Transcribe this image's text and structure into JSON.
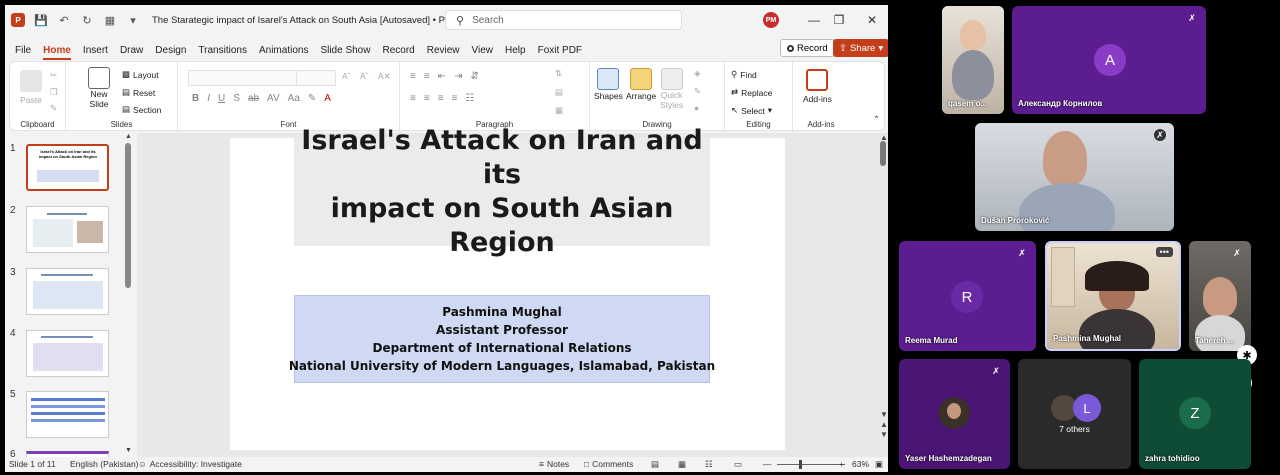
{
  "window": {
    "title": "The Starategic impact of Isarel's Attack on South Asia [Autosaved]  •  PowerP...",
    "search_placeholder": "Search",
    "user_initials": "PM"
  },
  "menu": {
    "tabs": [
      "File",
      "Home",
      "Insert",
      "Draw",
      "Design",
      "Transitions",
      "Animations",
      "Slide Show",
      "Record",
      "Review",
      "View",
      "Help",
      "Foxit PDF"
    ],
    "active": "Home",
    "record_label": "Record",
    "share_label": "Share"
  },
  "ribbon": {
    "clipboard": {
      "paste": "Paste",
      "label": "Clipboard"
    },
    "slides": {
      "new_slide": "New",
      "new_slide2": "Slide",
      "layout": "Layout",
      "reset": "Reset",
      "section": "Section",
      "label": "Slides"
    },
    "font": {
      "label": "Font"
    },
    "paragraph": {
      "label": "Paragraph"
    },
    "drawing": {
      "shapes": "Shapes",
      "arrange": "Arrange",
      "quick_styles": "Quick",
      "quick_styles2": "Styles",
      "label": "Drawing"
    },
    "editing": {
      "find": "Find",
      "replace": "Replace",
      "select": "Select",
      "label": "Editing"
    },
    "addins": {
      "addins": "Add-ins",
      "label": "Add-ins"
    }
  },
  "thumbnails": {
    "numbers": [
      "1",
      "2",
      "3",
      "4",
      "5",
      "6"
    ],
    "thumb1_title": "Israel's Attack on Iran and its impact on South Asian Region"
  },
  "slide": {
    "title_line1": "Israel's Attack on Iran and its",
    "title_line2": "impact on South Asian Region",
    "author_lines": [
      "Pashmina Mughal",
      "Assistant Professor",
      "Department of International Relations",
      "National University of Modern Languages, Islamabad, Pakistan"
    ]
  },
  "status": {
    "slide_count": "Slide 1 of 11",
    "language": "English (Pakistan)",
    "accessibility": "Accessibility: Investigate",
    "notes": "Notes",
    "comments": "Comments",
    "zoom": "63%",
    "zoom_level": 0.63
  },
  "participants": {
    "p1": "qasem o...",
    "p2": "Александр Корнилов",
    "p2_initial": "A",
    "p3": "Dušan Proroković",
    "p4": "Reema Murad",
    "p4_initial": "R",
    "p5": "Pashmina Mughal",
    "p6": "Tahereh ...",
    "p7": "Yaser Hashemzadegan",
    "p8": "7 others",
    "p8_initial": "L",
    "p9": "zahra tohidioo",
    "p9_initial": "Z"
  },
  "colors": {
    "accent": "#c43e1c",
    "tile_purple": "#5b1d8f",
    "tile_green": "#0f4c35",
    "author_box": "#cfd9f3"
  }
}
